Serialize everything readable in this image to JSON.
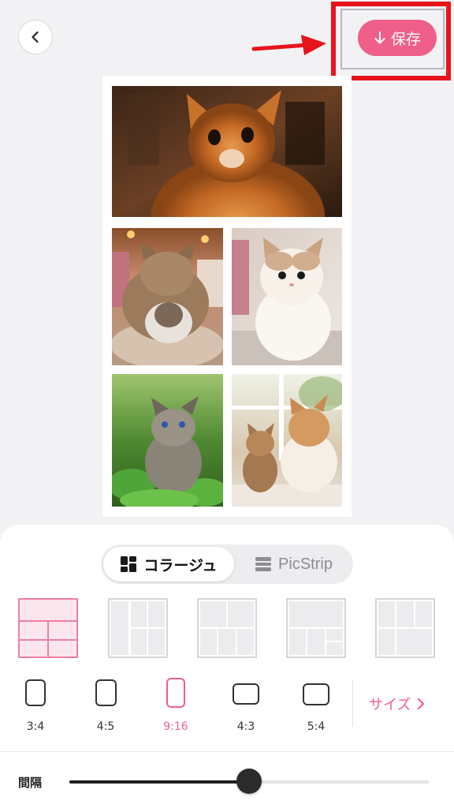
{
  "header": {
    "back_icon": "chevron-left-icon",
    "save_label": "保存",
    "save_icon": "arrow-down-icon",
    "accent_color": "#ef5f8a",
    "highlight_color": "#e8141c"
  },
  "collage": {
    "photos": [
      {
        "subject": "orange kitten"
      },
      {
        "subject": "mother cat and kitten on blanket"
      },
      {
        "subject": "fluffy white and cream kitten"
      },
      {
        "subject": "grey tabby kitten in plants"
      },
      {
        "subject": "two cats by window"
      }
    ]
  },
  "mode_tabs": {
    "collage_label": "コラージュ",
    "picstrip_label": "PicStrip",
    "selected": "collage"
  },
  "ratios": [
    {
      "label": "3:4"
    },
    {
      "label": "4:5"
    },
    {
      "label": "9:16",
      "selected": true
    },
    {
      "label": "4:3"
    },
    {
      "label": "5:4"
    }
  ],
  "size_label": "サイズ",
  "spacing": {
    "label": "間隔",
    "value_fraction": 0.5
  }
}
